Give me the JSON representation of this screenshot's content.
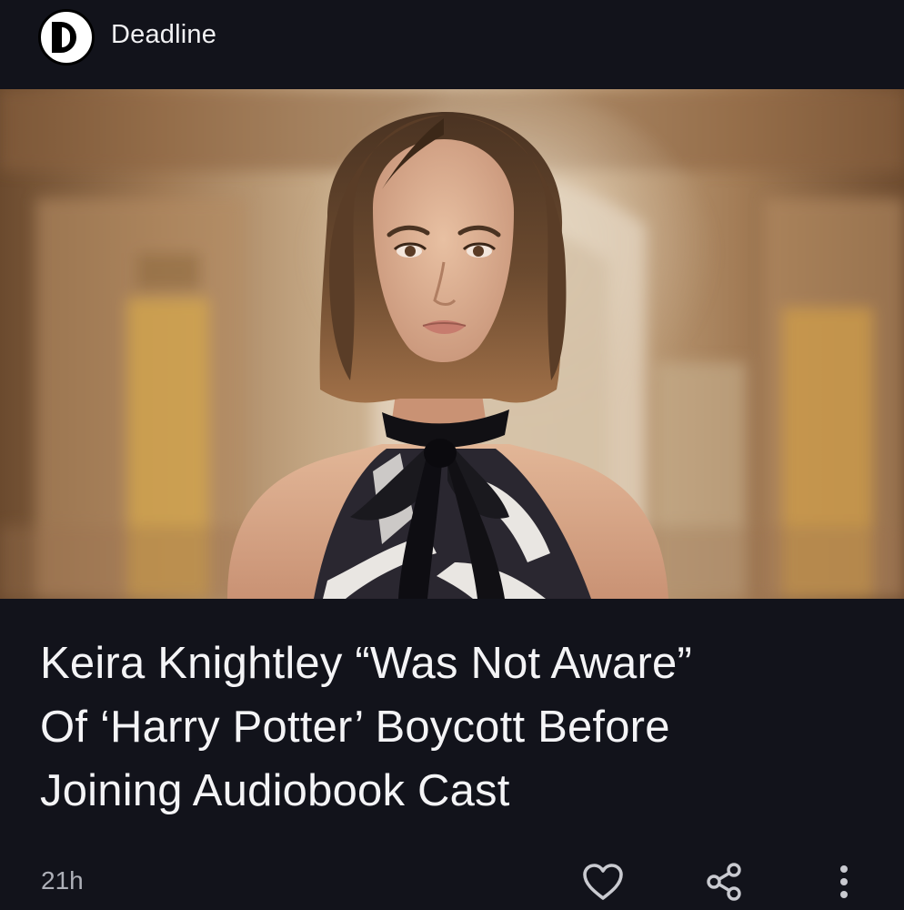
{
  "source": {
    "name": "Deadline",
    "logo_letter": "D"
  },
  "hero_image": {
    "subject": "portrait-photo"
  },
  "article": {
    "headline_lines": [
      "Keira Knightley “Was Not Aware”",
      "Of ‘Harry Potter’ Boycott Before",
      "Joining Audiobook Cast"
    ],
    "age": "21h"
  },
  "actions": {
    "like_icon": "heart-outline-icon",
    "share_icon": "share-icon",
    "more_icon": "more-vertical-icon"
  },
  "colors": {
    "background": "#12131b",
    "text": "#f4f4f6",
    "muted_text": "#aeb0b8",
    "icon": "#c9cad0"
  }
}
